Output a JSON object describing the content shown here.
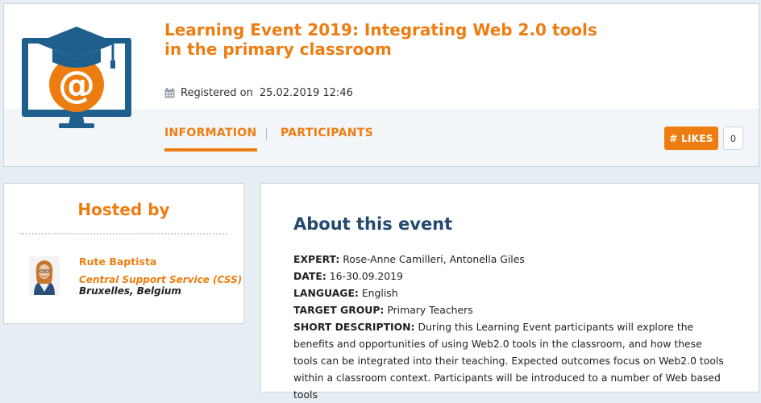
{
  "event": {
    "title": "Learning Event 2019: Integrating Web 2.0 tools in the primary classroom",
    "registered_label": "Registered on",
    "registered_date": "25.02.2019 12:46"
  },
  "tabs": [
    {
      "label": "INFORMATION",
      "active": true
    },
    {
      "label": "PARTICIPANTS",
      "active": false
    }
  ],
  "likes": {
    "label": "# LIKES",
    "count": "0"
  },
  "hosted": {
    "title": "Hosted by",
    "name": "Rute Baptista",
    "organisation": "Central Support Service (CSS)",
    "location": "Bruxelles, Belgium"
  },
  "about": {
    "title": "About this event",
    "fields": [
      {
        "label": "EXPERT:",
        "value": "Rose-Anne Camilleri, Antonella Giles"
      },
      {
        "label": "DATE:",
        "value": "16-30.09.2019"
      },
      {
        "label": "LANGUAGE:",
        "value": "English"
      },
      {
        "label": "TARGET GROUP:",
        "value": "Primary Teachers"
      },
      {
        "label": "SHORT DESCRIPTION:",
        "value": "During this Learning Event participants will explore the benefits and opportunities of using Web2.0 tools in the classroom, and how these tools can be integrated into their teaching. Expected outcomes focus on Web2.0 tools within a classroom context. Participants will be introduced to a number of Web based tools"
      }
    ]
  },
  "icons": {
    "logo": "computer-graduation-at-logo",
    "calendar": "calendar-icon"
  },
  "colors": {
    "accent": "#ee7d11",
    "heading_blue": "#234a6e",
    "logo_blue": "#1f5f8e",
    "page_bg": "#e6eef4"
  }
}
